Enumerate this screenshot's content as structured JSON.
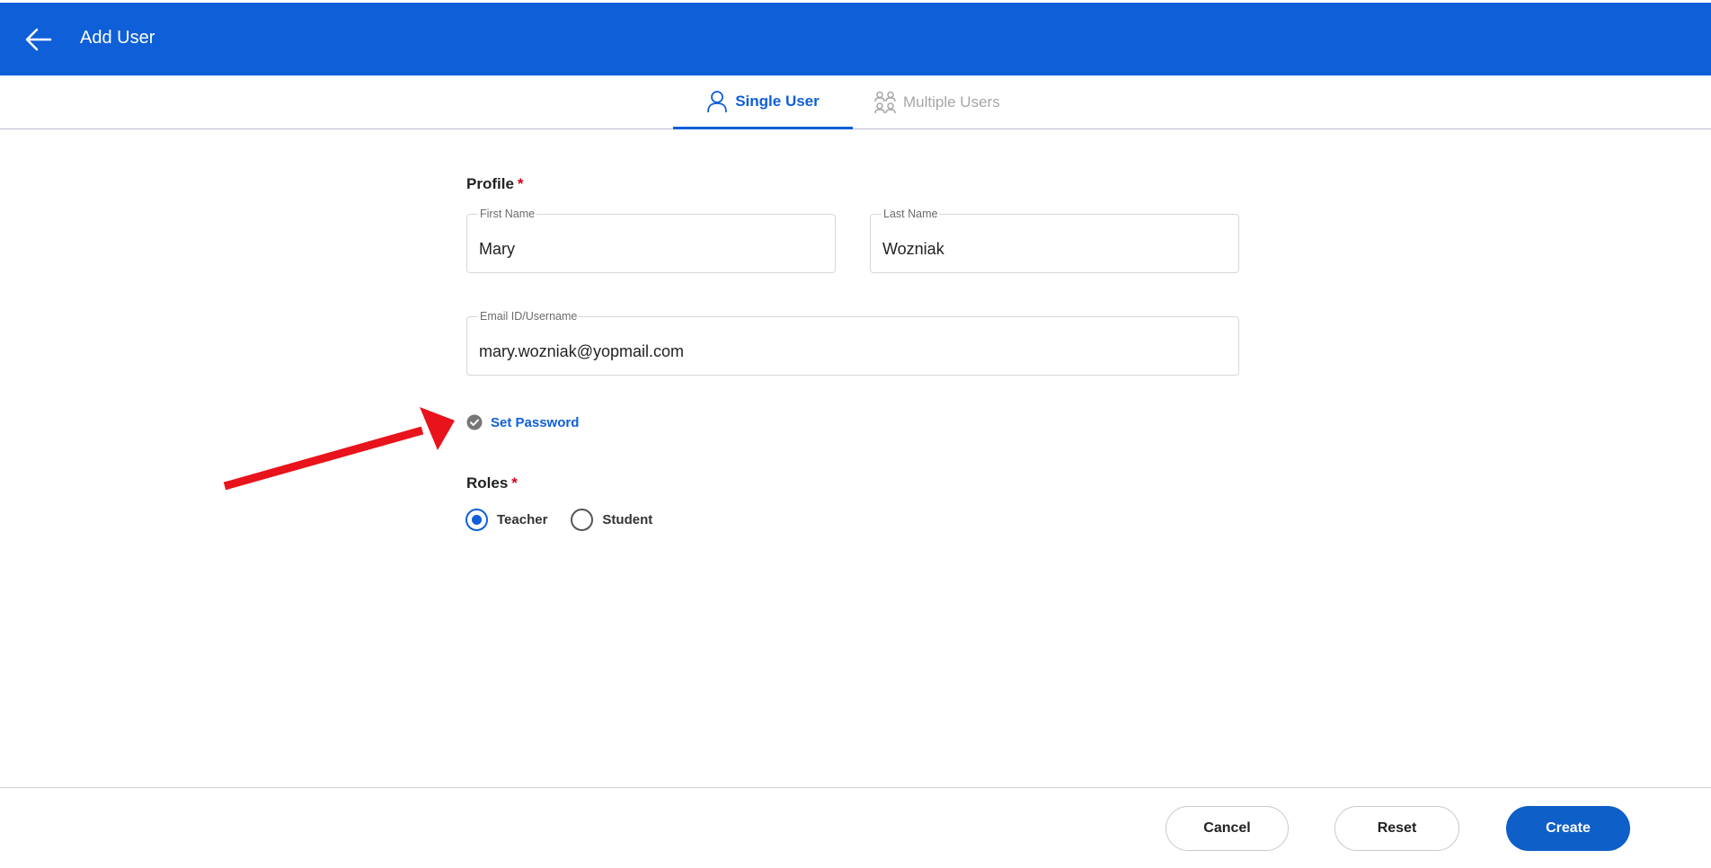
{
  "header": {
    "title": "Add User",
    "back_icon": "arrow-left-icon"
  },
  "tabs": [
    {
      "label": "Single User",
      "icon": "user-icon",
      "active": true
    },
    {
      "label": "Multiple Users",
      "icon": "users-icon",
      "active": false
    }
  ],
  "profile": {
    "section_label": "Profile",
    "required_mark": "*",
    "first_name": {
      "label": "First Name",
      "value": "Mary"
    },
    "last_name": {
      "label": "Last Name",
      "value": "Wozniak"
    },
    "email": {
      "label": "Email ID/Username",
      "value": "mary.wozniak@yopmail.com"
    }
  },
  "set_password": {
    "label": "Set Password",
    "icon": "check-circle-icon"
  },
  "roles": {
    "section_label": "Roles",
    "required_mark": "*",
    "options": [
      {
        "label": "Teacher",
        "selected": true
      },
      {
        "label": "Student",
        "selected": false
      }
    ]
  },
  "footer": {
    "cancel_label": "Cancel",
    "reset_label": "Reset",
    "create_label": "Create"
  },
  "colors": {
    "primary": "#0e5fd8",
    "required": "#d0021b",
    "annotation_arrow": "#e8131b"
  }
}
